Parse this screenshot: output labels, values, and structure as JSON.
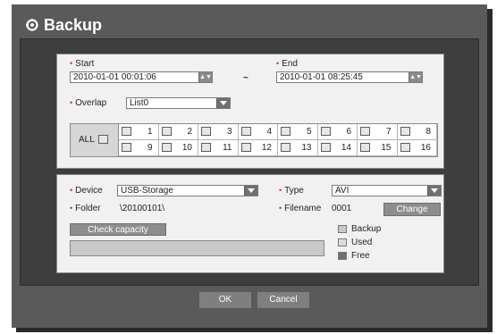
{
  "dialog": {
    "title": "Backup"
  },
  "time_range": {
    "start_label": "Start",
    "start_value": "2010-01-01 00:01:06",
    "separator": "~",
    "end_label": "End",
    "end_value": "2010-01-01 08:25:45"
  },
  "overlap": {
    "label": "Overlap",
    "value": "List0"
  },
  "channels": {
    "all_label": "ALL",
    "row1": [
      "1",
      "2",
      "3",
      "4",
      "5",
      "6",
      "7",
      "8"
    ],
    "row2": [
      "9",
      "10",
      "11",
      "12",
      "13",
      "14",
      "15",
      "16"
    ]
  },
  "device": {
    "label": "Device",
    "value": "USB-Storage"
  },
  "type": {
    "label": "Type",
    "value": "AVI"
  },
  "folder": {
    "label": "Folder",
    "value": "\\20100101\\"
  },
  "filename": {
    "label": "Filename",
    "value": "0001",
    "change_button": "Change"
  },
  "capacity": {
    "check_button": "Check capacity",
    "legend": [
      {
        "label": "Backup",
        "color": "#c8c8c8"
      },
      {
        "label": "Used",
        "color": "#dcdcdc"
      },
      {
        "label": "Free",
        "color": "#6e6e6e"
      }
    ]
  },
  "footer": {
    "ok_label": "OK",
    "cancel_label": "Cancel"
  }
}
